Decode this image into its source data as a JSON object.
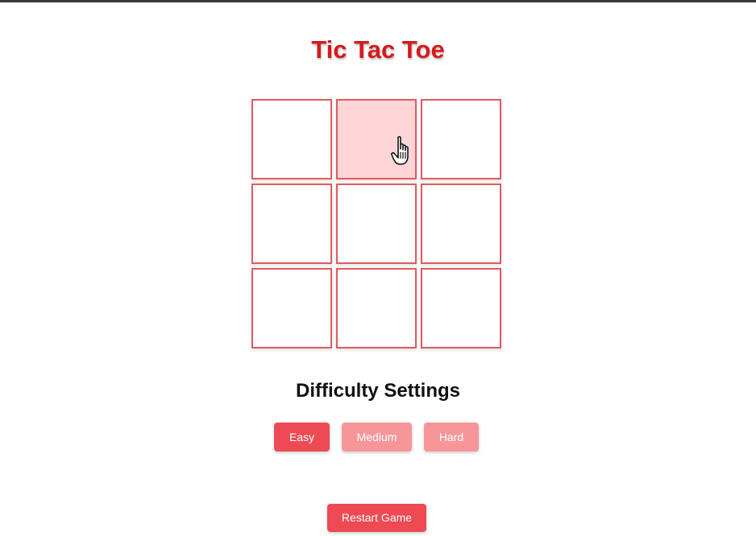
{
  "title": "Tic Tac Toe",
  "board": {
    "cells": [
      "",
      "",
      "",
      "",
      "",
      "",
      "",
      "",
      ""
    ],
    "hovered_cell_index": 1
  },
  "difficulty": {
    "heading": "Difficulty Settings",
    "options": [
      "Easy",
      "Medium",
      "Hard"
    ],
    "selected": "Easy"
  },
  "restart_label": "Restart Game",
  "colors": {
    "title": "#d7191c",
    "cell_border": "#e05a5f",
    "cell_hover_bg": "#ffd6d8",
    "button_active": "#ee4a54",
    "button_inactive": "#f79699"
  },
  "icons": {
    "cursor": "hand-pointer-icon"
  }
}
